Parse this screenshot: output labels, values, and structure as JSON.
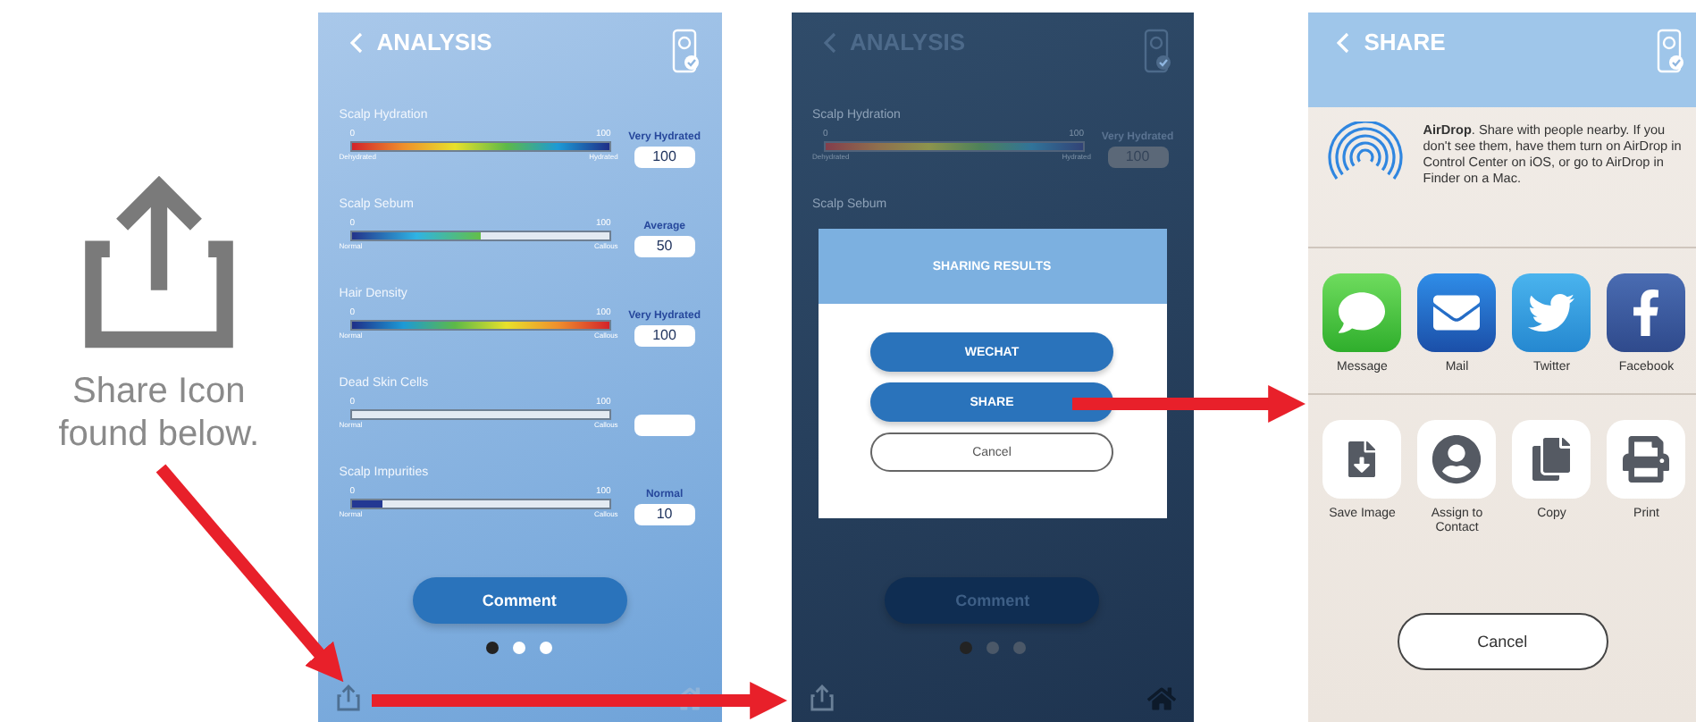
{
  "caption": "Share Icon found below.",
  "analysis": {
    "title": "ANALYSIS",
    "metrics": [
      {
        "name": "Scalp Hydration",
        "min": "0",
        "max": "100",
        "low": "Dehydrated",
        "high": "Hydrated",
        "kind": "spectrum",
        "level": 1,
        "status": "Very Hydrated",
        "value": "100"
      },
      {
        "name": "Scalp Sebum",
        "min": "0",
        "max": "100",
        "low": "Normal",
        "high": "Callous",
        "kind": "sebum",
        "level": 0.5,
        "status": "Average",
        "value": "50"
      },
      {
        "name": "Hair Density",
        "min": "0",
        "max": "100",
        "low": "Normal",
        "high": "Callous",
        "kind": "spectrum-reversed",
        "level": 1,
        "status": "Very Hydrated",
        "value": "100"
      },
      {
        "name": "Dead Skin Cells",
        "min": "0",
        "max": "100",
        "low": "Normal",
        "high": "Callous"
      },
      {
        "name": "Scalp Impurities",
        "min": "0",
        "max": "100",
        "low": "Normal",
        "high": "Callous",
        "kind": "solid",
        "level": 0.12,
        "status": "Normal",
        "value": "10"
      }
    ],
    "comment": "Comment",
    "pages": [
      {
        "selected": true
      },
      {
        "selected": false
      },
      {
        "selected": false
      }
    ]
  },
  "dialog_screen": {
    "title": "ANALYSIS",
    "metrics": [
      {
        "name": "Scalp Hydration",
        "min": "0",
        "max": "100",
        "low": "Dehydrated",
        "high": "Hydrated",
        "kind": "spectrum",
        "level": 1,
        "status": "Very Hydrated",
        "value": "100"
      },
      {
        "name": "Scalp Sebum"
      }
    ],
    "dialog": {
      "title": "SHARING RESULTS",
      "buttons": [
        {
          "label": "WECHAT",
          "kind": "primary"
        },
        {
          "label": "SHARE",
          "kind": "primary"
        },
        {
          "label": "Cancel",
          "kind": "outline"
        }
      ]
    },
    "comment": "Comment",
    "pages": [
      {
        "selected": true
      },
      {
        "selected": false
      },
      {
        "selected": false
      }
    ]
  },
  "share_sheet": {
    "title": "SHARE",
    "airdrop": "**AirDrop**. Share with people nearby. If you don't see them, have them turn on AirDrop in Control Center on iOS, or go to AirDrop in Finder on a Mac.",
    "apps": [
      {
        "label": "Message",
        "kind": "message"
      },
      {
        "label": "Mail",
        "kind": "mail"
      },
      {
        "label": "Twitter",
        "kind": "twitter"
      },
      {
        "label": "Facebook",
        "kind": "facebook"
      }
    ],
    "actions": [
      {
        "label": "Save Image",
        "kind": "save"
      },
      {
        "label": "Assign to Contact",
        "kind": "contact"
      },
      {
        "label": "Copy",
        "kind": "copy"
      },
      {
        "label": "Print",
        "kind": "print"
      }
    ],
    "cancel": "Cancel"
  }
}
